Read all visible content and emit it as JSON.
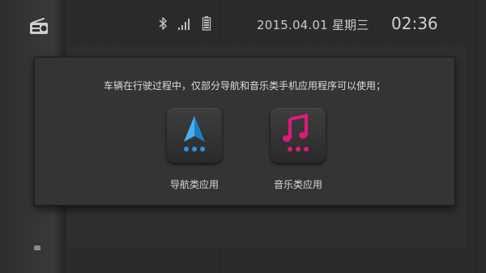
{
  "statusbar": {
    "radio_icon": "radio-icon",
    "bluetooth_icon": "bluetooth-icon",
    "signal_icon": "signal-icon",
    "battery_icon": "battery-icon",
    "date": "2015.04.01 星期三",
    "time": "02:36"
  },
  "dialog": {
    "message": "车辆在行驶过程中，仅部分导航和音乐类手机应用程序可以使用；",
    "apps": [
      {
        "label": "导航类应用",
        "icon": "navigation-arrow-icon",
        "color": "#2e93e0"
      },
      {
        "label": "音乐类应用",
        "icon": "music-note-icon",
        "color": "#e0197d"
      }
    ]
  }
}
